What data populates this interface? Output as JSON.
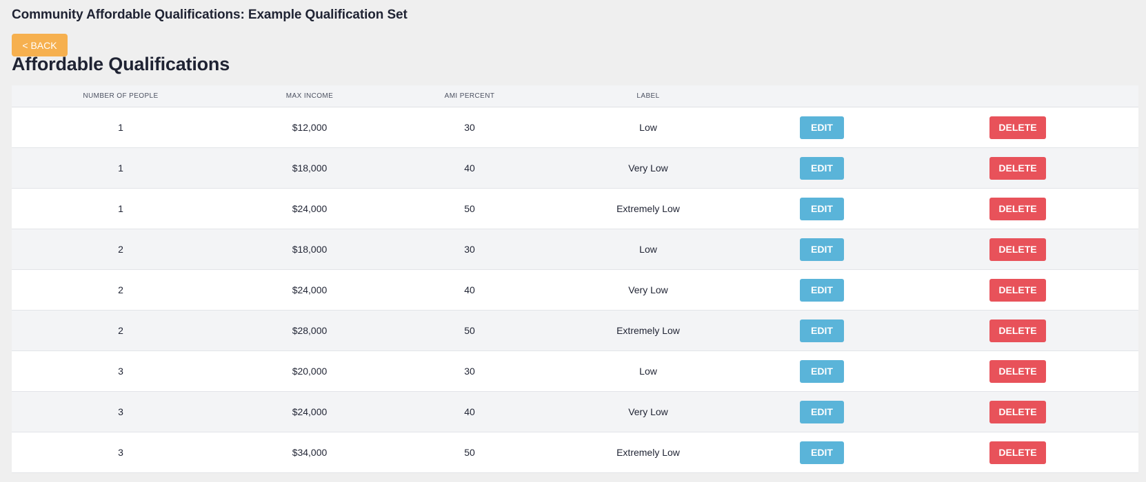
{
  "header": {
    "title": "Community Affordable Qualifications: Example Qualification Set",
    "back_label": "< BACK"
  },
  "section": {
    "title": "Affordable Qualifications"
  },
  "table": {
    "columns": [
      "NUMBER OF PEOPLE",
      "MAX INCOME",
      "AMI PERCENT",
      "LABEL",
      "",
      ""
    ],
    "rows": [
      {
        "people": "1",
        "max_income": "$12,000",
        "ami_percent": "30",
        "label": "Low"
      },
      {
        "people": "1",
        "max_income": "$18,000",
        "ami_percent": "40",
        "label": "Very Low"
      },
      {
        "people": "1",
        "max_income": "$24,000",
        "ami_percent": "50",
        "label": "Extremely Low"
      },
      {
        "people": "2",
        "max_income": "$18,000",
        "ami_percent": "30",
        "label": "Low"
      },
      {
        "people": "2",
        "max_income": "$24,000",
        "ami_percent": "40",
        "label": "Very Low"
      },
      {
        "people": "2",
        "max_income": "$28,000",
        "ami_percent": "50",
        "label": "Extremely Low"
      },
      {
        "people": "3",
        "max_income": "$20,000",
        "ami_percent": "30",
        "label": "Low"
      },
      {
        "people": "3",
        "max_income": "$24,000",
        "ami_percent": "40",
        "label": "Very Low"
      },
      {
        "people": "3",
        "max_income": "$34,000",
        "ami_percent": "50",
        "label": "Extremely Low"
      }
    ],
    "edit_label": "EDIT",
    "delete_label": "DELETE"
  },
  "colors": {
    "back_button": "#f6b04f",
    "edit_button": "#5ab4d9",
    "delete_button": "#e8525a"
  }
}
